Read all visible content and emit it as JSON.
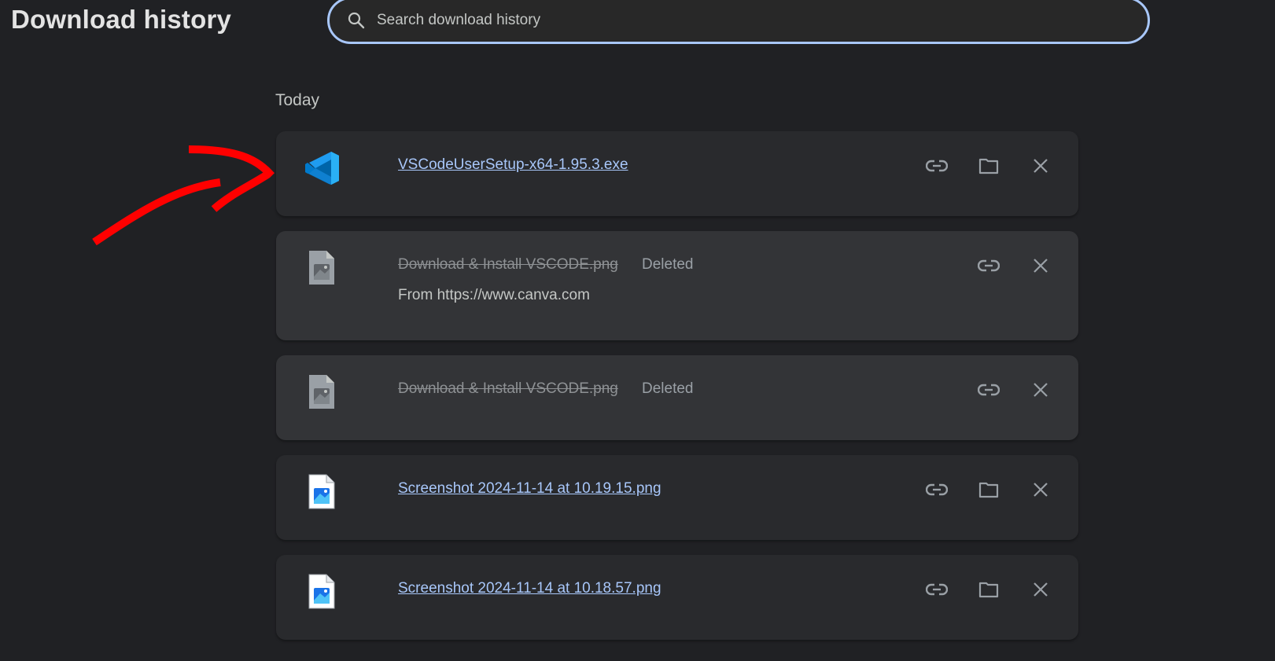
{
  "header": {
    "title": "Download history",
    "search_placeholder": "Search download history",
    "search_value": ""
  },
  "sections": [
    {
      "label": "Today",
      "items": [
        {
          "file_name": "VSCodeUserSetup-x64-1.95.3.exe",
          "icon": "vscode-icon",
          "status": "",
          "origin": "",
          "deleted": false,
          "actions": [
            "copy-link",
            "show-in-folder",
            "remove"
          ]
        },
        {
          "file_name": "Download & Install VSCODE.png",
          "icon": "image-file-icon",
          "status": "Deleted",
          "origin": "From https://www.canva.com",
          "deleted": true,
          "actions": [
            "copy-link",
            "remove"
          ]
        },
        {
          "file_name": "Download & Install VSCODE.png",
          "icon": "image-file-icon",
          "status": "Deleted",
          "origin": "",
          "deleted": true,
          "actions": [
            "copy-link",
            "remove"
          ]
        },
        {
          "file_name": "Screenshot 2024-11-14 at 10.19.15.png",
          "icon": "image-file-icon",
          "status": "",
          "origin": "",
          "deleted": false,
          "actions": [
            "copy-link",
            "show-in-folder",
            "remove"
          ]
        },
        {
          "file_name": "Screenshot 2024-11-14 at 10.18.57.png",
          "icon": "image-file-icon",
          "status": "",
          "origin": "",
          "deleted": false,
          "actions": [
            "copy-link",
            "show-in-folder",
            "remove"
          ]
        }
      ]
    }
  ],
  "action_labels": {
    "copy-link": "Copy download link",
    "show-in-folder": "Show in folder",
    "remove": "Remove from list"
  },
  "colors": {
    "background": "#202124",
    "card": "#292a2d",
    "card_deleted": "#333437",
    "link": "#a8c7fa",
    "search_border": "#a8c7fa",
    "annotation_arrow": "#ff0000"
  }
}
